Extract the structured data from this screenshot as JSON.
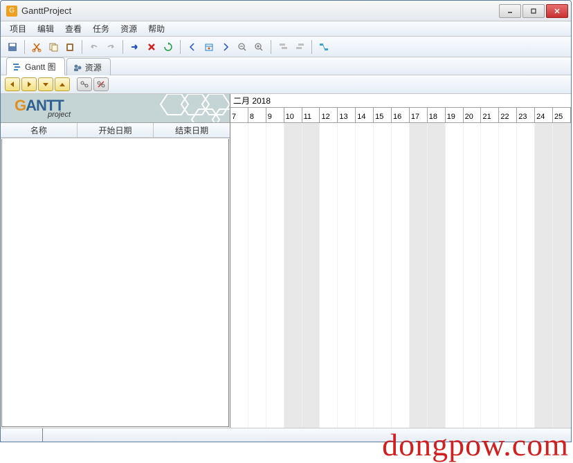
{
  "window": {
    "title": "GanttProject"
  },
  "menu": {
    "project": "项目",
    "edit": "编辑",
    "view": "查看",
    "tasks": "任务",
    "resources": "资源",
    "help": "帮助"
  },
  "tabs": {
    "gantt": "Gantt 图",
    "resources": "资源"
  },
  "tree_columns": {
    "name": "名称",
    "start": "开始日期",
    "end": "结束日期"
  },
  "logo": {
    "main": "GANTT",
    "sub": "project"
  },
  "timeline": {
    "month_label": "二月 2018",
    "days": [
      "7",
      "8",
      "9",
      "10",
      "11",
      "12",
      "13",
      "14",
      "15",
      "16",
      "17",
      "18",
      "19",
      "20",
      "21",
      "22",
      "23",
      "24",
      "25"
    ],
    "weekend_indices": [
      3,
      4,
      10,
      11,
      17,
      18
    ]
  },
  "watermark": "dongpow.com"
}
